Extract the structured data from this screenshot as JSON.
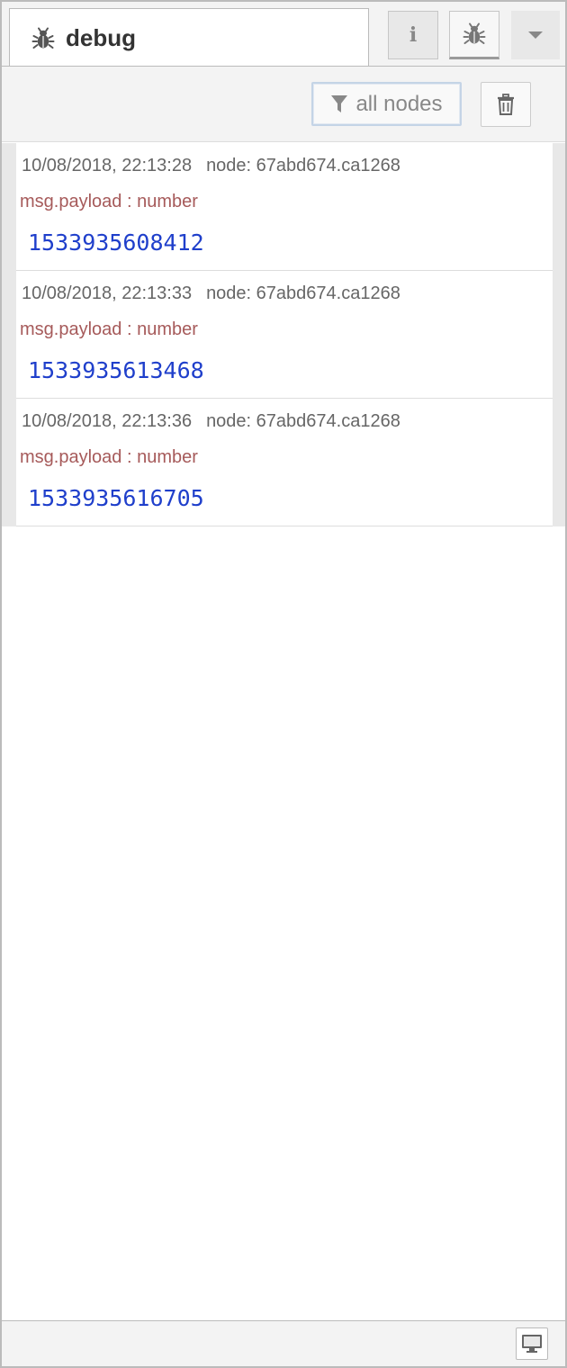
{
  "sidebar": {
    "active_tab": {
      "label": "debug",
      "icon": "bug-icon"
    },
    "tab_buttons": [
      {
        "icon": "info-icon",
        "glyph": "i"
      },
      {
        "icon": "bug-icon"
      },
      {
        "icon": "chevron-down-icon"
      }
    ]
  },
  "toolbar": {
    "filter_label": "all nodes",
    "filter_icon": "filter-icon",
    "clear_icon": "trash-icon"
  },
  "messages": [
    {
      "timestamp": "10/08/2018, 22:13:28",
      "node": "node: 67abd674.ca1268",
      "property": "msg.payload : number",
      "value": "1533935608412"
    },
    {
      "timestamp": "10/08/2018, 22:13:33",
      "node": "node: 67abd674.ca1268",
      "property": "msg.payload : number",
      "value": "1533935613468"
    },
    {
      "timestamp": "10/08/2018, 22:13:36",
      "node": "node: 67abd674.ca1268",
      "property": "msg.payload : number",
      "value": "1533935616705"
    }
  ],
  "footer": {
    "popout_icon": "monitor-icon"
  },
  "colors": {
    "property": "#a65a5a",
    "value": "#1f3fcb",
    "meta": "#666666"
  }
}
